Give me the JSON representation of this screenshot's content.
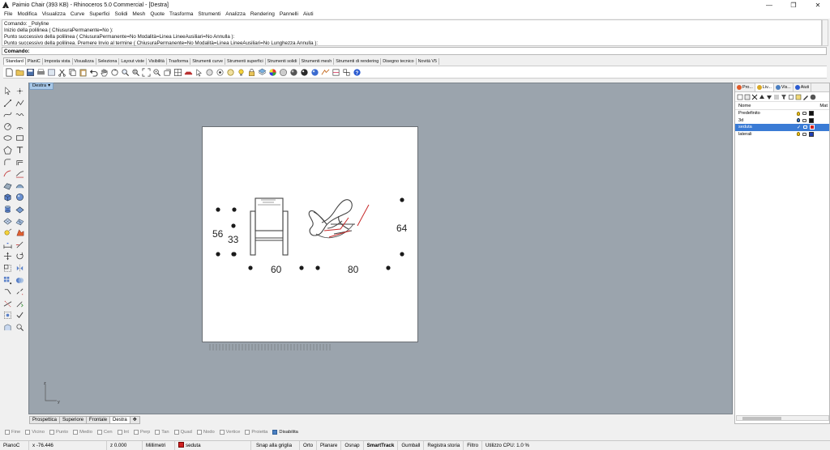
{
  "window": {
    "title": "Paimio Chair (393 KB) - Rhinoceros 5.0 Commercial - [Destra]",
    "controls": [
      "—",
      "❐",
      "✕"
    ]
  },
  "menu": [
    "File",
    "Modifica",
    "Visualizza",
    "Curve",
    "Superfici",
    "Solidi",
    "Mesh",
    "Quote",
    "Trasforma",
    "Strumenti",
    "Analizza",
    "Rendering",
    "Pannelli",
    "Aiuti"
  ],
  "command_history": [
    "Comando: _Polyline",
    "Inizio della polilinea ( ChiusuraPermanente=No ):",
    "Punto successivo della polilinea ( ChiusuraPermanente=No  Modalità=Linea  LineeAusiliari=No  Annulla ):",
    "Punto successivo della polilinea. Premere Invio al termine ( ChiusuraPermanente=No  Modalità=Linea  LineeAusiliari=No  Lunghezza  Annulla ):"
  ],
  "command_prompt": {
    "label": "Comando:",
    "value": ""
  },
  "toolbar_tabs": [
    "Standard",
    "PlaniC",
    "Imposta vista",
    "Visualizza",
    "Seleziona",
    "Layout viste",
    "Visibilità",
    "Trasforma",
    "Strumenti curve",
    "Strumenti superfici",
    "Strumenti solidi",
    "Strumenti mesh",
    "Strumenti di rendering",
    "Disegno tecnico",
    "Novità V5"
  ],
  "toolbar_active_tab": "Standard",
  "viewport": {
    "name": "Destra",
    "dimensions": {
      "d56": "56",
      "d33": "33",
      "d60": "60",
      "d80": "80",
      "d64": "64"
    },
    "axis": {
      "x": "y",
      "y": "z"
    }
  },
  "view_tabs": [
    "Prospettica",
    "Superiore",
    "Frontale",
    "Destra",
    "✥"
  ],
  "view_active": "Destra",
  "osnaps": [
    {
      "label": "Fine",
      "on": false
    },
    {
      "label": "Vicino",
      "on": false
    },
    {
      "label": "Punto",
      "on": false
    },
    {
      "label": "Medio",
      "on": false
    },
    {
      "label": "Cen",
      "on": false
    },
    {
      "label": "Int",
      "on": false
    },
    {
      "label": "Perp",
      "on": false
    },
    {
      "label": "Tan",
      "on": false
    },
    {
      "label": "Quad",
      "on": false
    },
    {
      "label": "Nodo",
      "on": false
    },
    {
      "label": "Vertice",
      "on": false
    },
    {
      "label": "Proietta",
      "on": false
    },
    {
      "label": "Disabilita",
      "on": true
    }
  ],
  "status": {
    "cplane": "PianoC",
    "x": "x -76.446",
    "z": "z 0.000",
    "units": "Millimetri",
    "layer": "seduta",
    "snap_grid": "Snap alla griglia",
    "ortho": "Orto",
    "planar": "Planare",
    "osnap": "Osnap",
    "smarttrack": "SmartTrack",
    "gumball": "Gumball",
    "history": "Registra storia",
    "filter": "Filtro",
    "cpu": "Utilizzo CPU: 1.0 %"
  },
  "panel": {
    "tabs": [
      "Pro...",
      "Liv...",
      "Vis...",
      "Aiuti"
    ],
    "active_tab": "Liv...",
    "col_name": "Nome",
    "col_mat": "Mat",
    "layers": [
      {
        "name": "Predefinito",
        "color": "#111111",
        "selected": false
      },
      {
        "name": "3d",
        "color": "#111111",
        "selected": false
      },
      {
        "name": "seduta",
        "color": "#d02020",
        "selected": true
      },
      {
        "name": "laterali",
        "color": "#1f3fb5",
        "selected": false
      }
    ]
  }
}
